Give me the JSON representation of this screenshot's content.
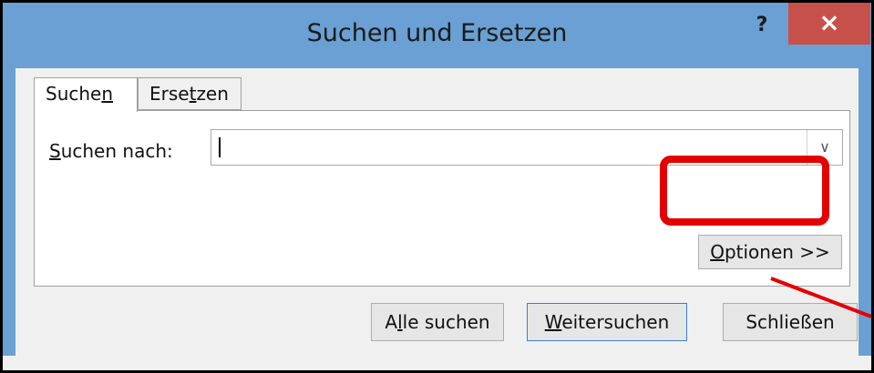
{
  "window": {
    "title": "Suchen und Ersetzen",
    "help_label": "?",
    "close_label": "×"
  },
  "tabs": [
    {
      "label_pre": "Suche",
      "label_mnemonic": "n",
      "label_post": "",
      "active": true
    },
    {
      "label_pre": "Erse",
      "label_mnemonic": "t",
      "label_post": "zen",
      "active": false
    }
  ],
  "search": {
    "label_mnemonic": "S",
    "label_rest": "uchen nach:",
    "value": "",
    "dropdown_icon": "chevron-down-icon"
  },
  "options_button": {
    "label_mnemonic": "O",
    "label_rest": "ptionen >>"
  },
  "buttons": {
    "find_all_pre": "A",
    "find_all_mnemonic": "l",
    "find_all_post": "le suchen",
    "find_next_mnemonic": "W",
    "find_next_post": "eitersuchen",
    "close": "Schließen"
  },
  "colors": {
    "titlebar": "#6aa0d3",
    "close_button": "#c7504b",
    "highlight": "#e40000"
  }
}
